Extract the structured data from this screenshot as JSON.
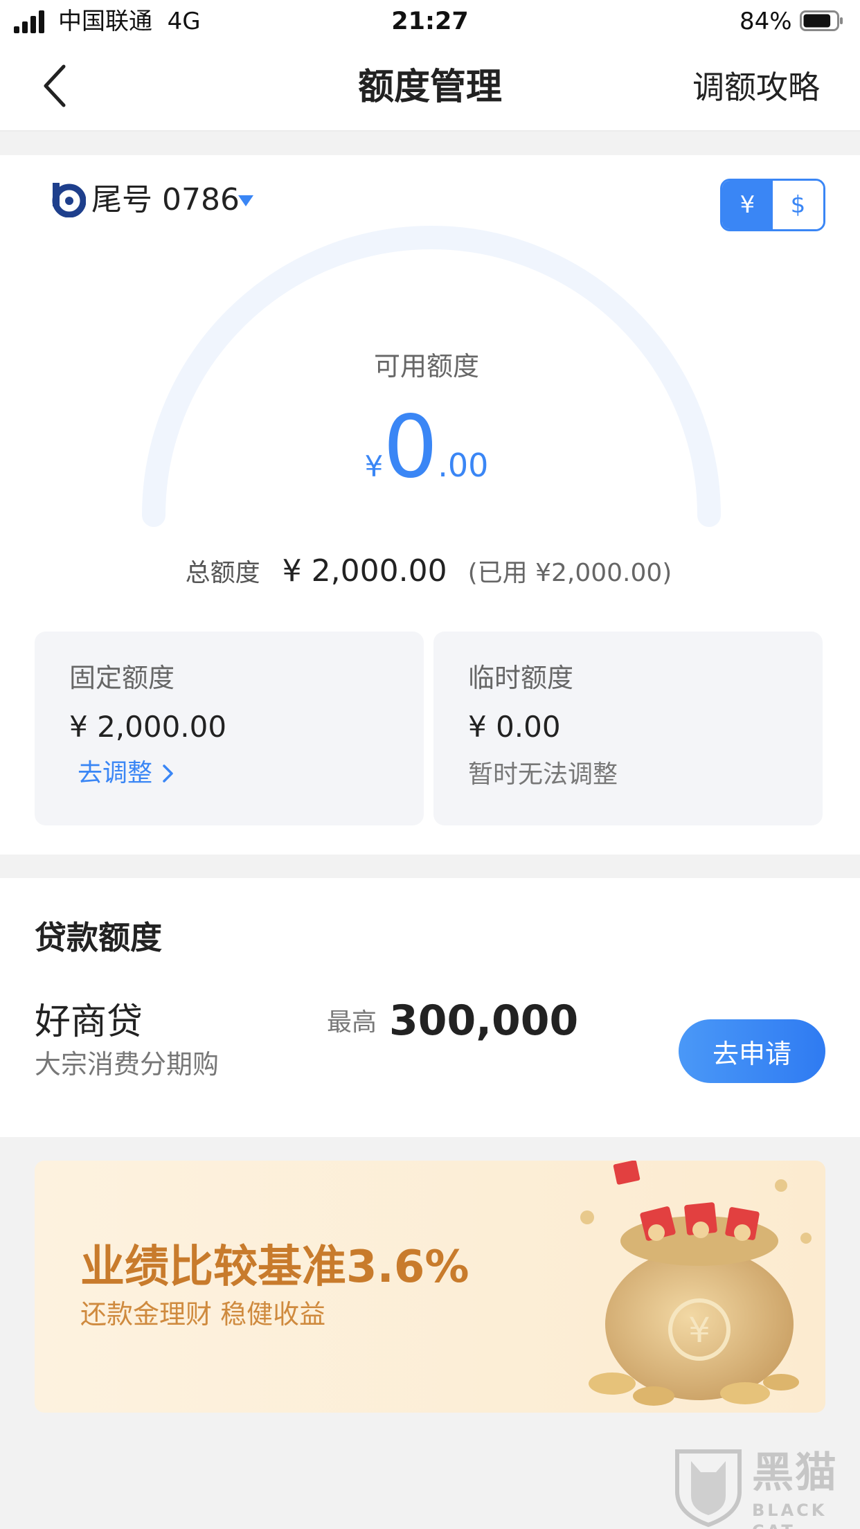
{
  "status_bar": {
    "carrier": "中国联通  4G",
    "time": "21:27",
    "battery_percent": "84%",
    "battery_level": 0.84
  },
  "nav": {
    "title": "额度管理",
    "right_link": "调额攻略"
  },
  "card": {
    "suffix_label": "尾号 0786",
    "currency_options": [
      "¥",
      "$"
    ],
    "selected_currency": "¥",
    "available_label": "可用额度",
    "available_symbol": "¥",
    "available_integer": "0",
    "available_decimal": ".00",
    "total_label": "总额度",
    "total_value": "¥ 2,000.00",
    "used_text": "(已用 ¥2,000.00)",
    "fixed": {
      "title": "固定额度",
      "amount": "¥ 2,000.00",
      "link": "去调整"
    },
    "temporary": {
      "title": "临时额度",
      "amount": "¥ 0.00",
      "note": "暂时无法调整"
    }
  },
  "loan": {
    "heading": "贷款额度",
    "product_name": "好商贷",
    "product_desc": "大宗消费分期购",
    "max_prefix": "最高",
    "max_value": "300,000",
    "apply_label": "去申请"
  },
  "banner": {
    "title": "业绩比较基准3.6%",
    "subtitle": "还款金理财 稳健收益"
  },
  "watermark": {
    "text": "黑猫",
    "sub": "BLACK CAT"
  },
  "colors": {
    "accent": "#3a86f5",
    "banner_text": "#c87b2c"
  }
}
